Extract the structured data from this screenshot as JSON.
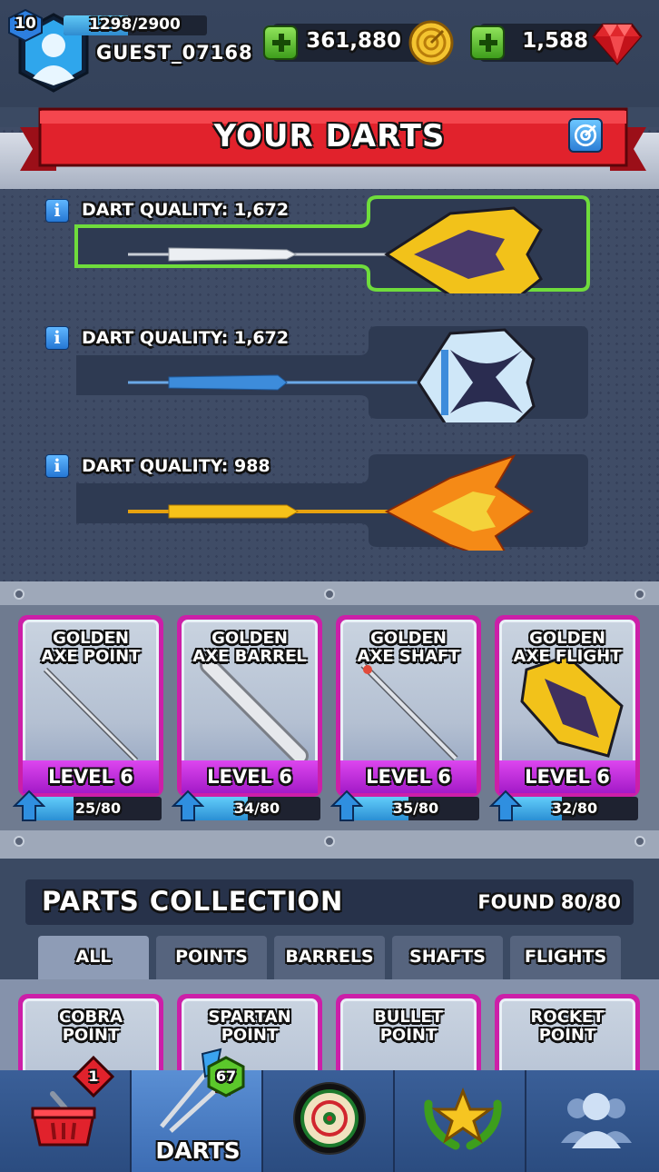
{
  "player": {
    "level": "10",
    "xp_text": "1298/2900",
    "xp_fraction": 0.45,
    "name": "GUEST_07168"
  },
  "currency": {
    "coins": "361,880",
    "gems": "1,588"
  },
  "darts_panel": {
    "title": "YOUR DARTS",
    "darts": [
      {
        "quality": "DART QUALITY: 1,672",
        "selected": true,
        "color": "#e9e9ee",
        "flight_color": "#f2c21a"
      },
      {
        "quality": "DART QUALITY: 1,672",
        "selected": false,
        "color": "#3d8cdb",
        "flight_color": "#cfe7f8"
      },
      {
        "quality": "DART QUALITY: 988",
        "selected": false,
        "color": "#f2b319",
        "flight_color": "#f58a16"
      }
    ]
  },
  "upgrade_cards": [
    {
      "title_1": "GOLDEN",
      "title_2": "AXE POINT",
      "level": "LEVEL 6",
      "progress": "25/80",
      "fraction": 0.31
    },
    {
      "title_1": "GOLDEN",
      "title_2": "AXE BARREL",
      "level": "LEVEL 6",
      "progress": "34/80",
      "fraction": 0.43
    },
    {
      "title_1": "GOLDEN",
      "title_2": "AXE SHAFT",
      "level": "LEVEL 6",
      "progress": "35/80",
      "fraction": 0.44
    },
    {
      "title_1": "GOLDEN",
      "title_2": "AXE FLIGHT",
      "level": "LEVEL 6",
      "progress": "32/80",
      "fraction": 0.4
    }
  ],
  "collection": {
    "title": "PARTS COLLECTION",
    "found": "FOUND 80/80",
    "tabs": [
      "ALL",
      "POINTS",
      "BARRELS",
      "SHAFTS",
      "FLIGHTS"
    ],
    "active_tab": "ALL",
    "items": [
      {
        "title_1": "COBRA",
        "title_2": "POINT"
      },
      {
        "title_1": "SPARTAN",
        "title_2": "POINT"
      },
      {
        "title_1": "BULLET",
        "title_2": "POINT"
      },
      {
        "title_1": "ROCKET",
        "title_2": "POINT"
      }
    ]
  },
  "bottom_nav": {
    "shop_badge": "1",
    "darts_badge": "67",
    "darts_label": "DARTS",
    "icons": [
      "basket-icon",
      "darts-icon",
      "dartboard-icon",
      "trophy-icon",
      "friends-icon"
    ]
  },
  "colors": {
    "card_border": "#cc1fa8",
    "level_band": "#c22ee0",
    "progress": "#3aa6e8",
    "selected_glow": "#6fdc3c"
  }
}
